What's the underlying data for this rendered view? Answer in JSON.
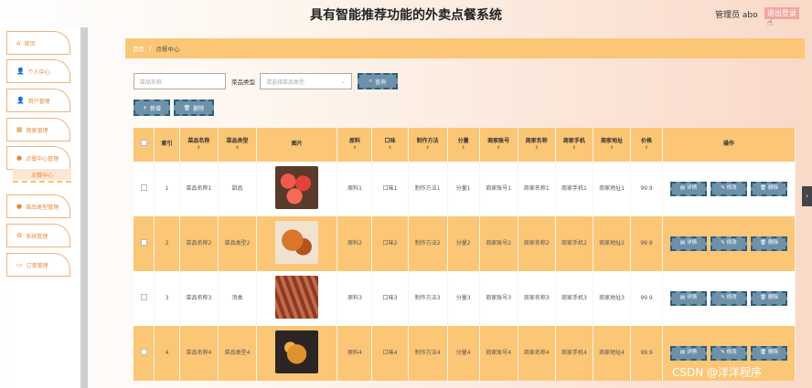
{
  "header": {
    "title": "具有智能推荐功能的外卖点餐系统",
    "user": "管理员 abo",
    "logout": "退出登录"
  },
  "sidebar": {
    "items": [
      {
        "label": "首页",
        "icon": "home-icon"
      },
      {
        "label": "个人中心",
        "icon": "user-icon"
      },
      {
        "label": "用户管理",
        "icon": "user-icon"
      },
      {
        "label": "商家管理",
        "icon": "store-icon"
      },
      {
        "label": "点餐中心管理",
        "icon": "location-icon"
      },
      {
        "label": "菜品类型管理",
        "icon": "location-icon"
      },
      {
        "label": "系统管理",
        "icon": "settings-icon"
      },
      {
        "label": "订单管理",
        "icon": "card-icon"
      }
    ],
    "submenu": "点餐中心"
  },
  "breadcrumb": {
    "home": "首页",
    "separator": "/",
    "current": "点餐中心"
  },
  "search": {
    "name_placeholder": "菜品名称",
    "type_label": "菜品类型",
    "type_placeholder": "请选择菜品类型",
    "button": "查询"
  },
  "actions": {
    "add": "新增",
    "delete": "删除"
  },
  "table": {
    "headers": [
      "索引",
      "菜品名称",
      "菜品类型",
      "图片",
      "原料",
      "口味",
      "制作方法",
      "分量",
      "商家账号",
      "商家名称",
      "商家手机",
      "商家地址",
      "价格",
      "操作"
    ],
    "buttons": {
      "detail": "详情",
      "edit": "修改",
      "delete": "删除"
    },
    "rows": [
      {
        "index": "1",
        "name": "菜品名称1",
        "type": "甜品",
        "material": "原料1",
        "taste": "口味1",
        "method": "制作方法1",
        "portion": "分量1",
        "account": "商家账号1",
        "shop": "商家名称1",
        "phone": "商家手机1",
        "address": "商家地址1",
        "price": "99.9"
      },
      {
        "index": "2",
        "name": "菜品名称2",
        "type": "菜品类型2",
        "material": "原料2",
        "taste": "口味2",
        "method": "制作方法2",
        "portion": "分量2",
        "account": "商家账号2",
        "shop": "商家名称2",
        "phone": "商家手机2",
        "address": "商家地址2",
        "price": "99.9"
      },
      {
        "index": "3",
        "name": "菜品名称3",
        "type": "汤类",
        "material": "原料3",
        "taste": "口味3",
        "method": "制作方法3",
        "portion": "分量3",
        "account": "商家账号3",
        "shop": "商家名称3",
        "phone": "商家手机3",
        "address": "商家地址3",
        "price": "99.9"
      },
      {
        "index": "4",
        "name": "菜品名称4",
        "type": "菜品类型4",
        "material": "原料4",
        "taste": "口味4",
        "method": "制作方法4",
        "portion": "分量4",
        "account": "商家账号4",
        "shop": "商家名称4",
        "phone": "商家手机4",
        "address": "商家地址4",
        "price": "99.9"
      }
    ]
  },
  "watermark": "CSDN @洋洋程序",
  "colors": {
    "accent": "#fbc676",
    "button": "#6e91aa",
    "sidebar_text": "#e58a3a"
  }
}
